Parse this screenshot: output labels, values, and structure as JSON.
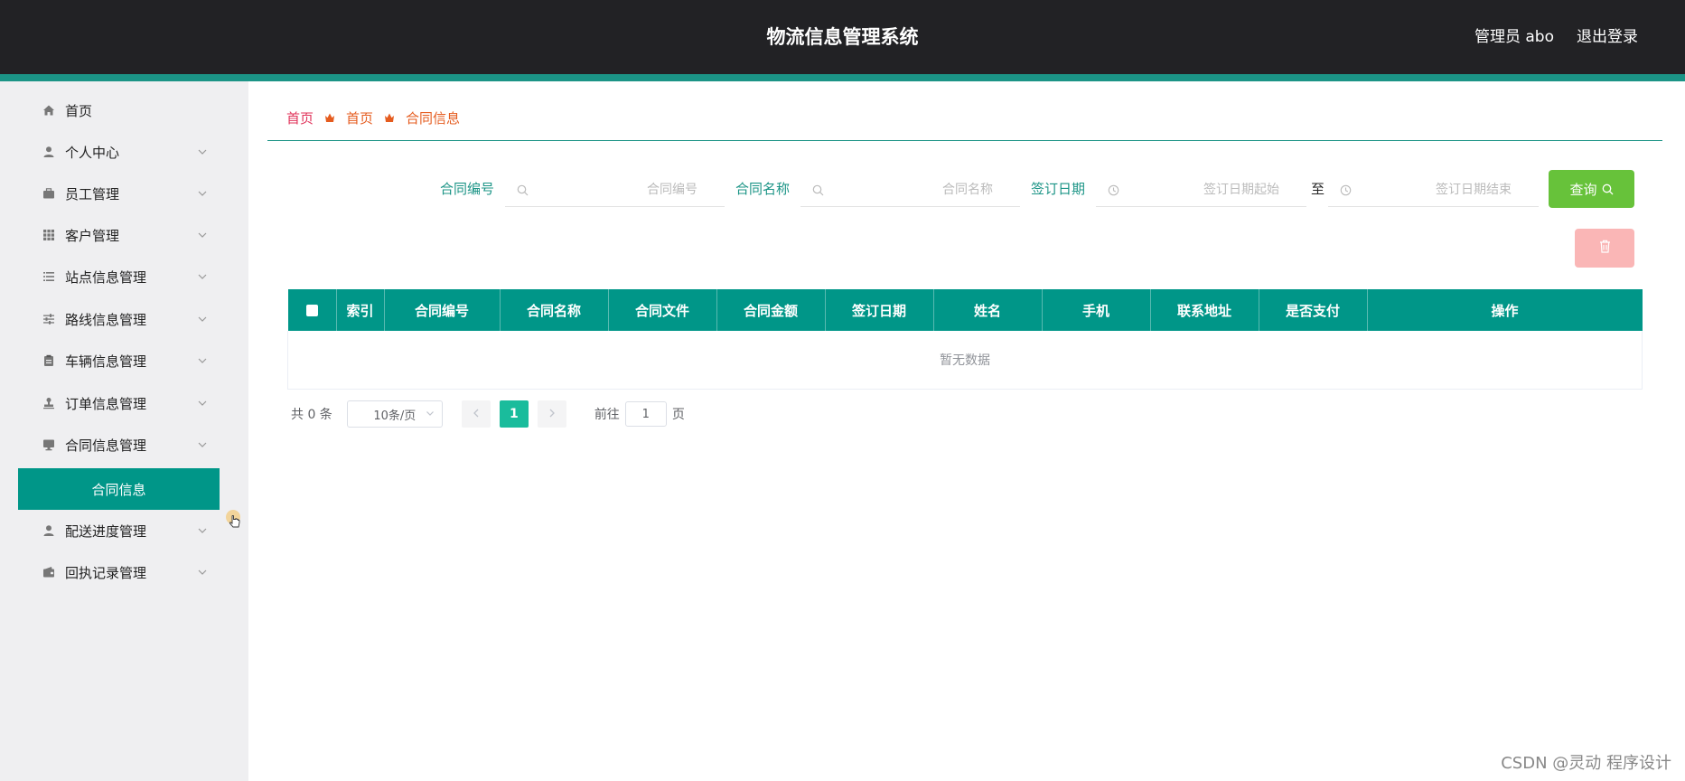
{
  "header": {
    "title": "物流信息管理系统",
    "admin": "管理员 abo",
    "logout": "退出登录"
  },
  "sidebar": {
    "items": [
      {
        "label": "首页",
        "icon": "home-icon",
        "chevron": false
      },
      {
        "label": "个人中心",
        "icon": "user-icon",
        "chevron": true
      },
      {
        "label": "员工管理",
        "icon": "briefcase-icon",
        "chevron": true
      },
      {
        "label": "客户管理",
        "icon": "grid-icon",
        "chevron": true
      },
      {
        "label": "站点信息管理",
        "icon": "list-icon",
        "chevron": true
      },
      {
        "label": "路线信息管理",
        "icon": "sliders-icon",
        "chevron": true
      },
      {
        "label": "车辆信息管理",
        "icon": "clipboard-icon",
        "chevron": true
      },
      {
        "label": "订单信息管理",
        "icon": "stamp-icon",
        "chevron": true
      },
      {
        "label": "合同信息管理",
        "icon": "monitor-icon",
        "chevron": true
      },
      {
        "label": "配送进度管理",
        "icon": "user-icon",
        "chevron": true
      },
      {
        "label": "回执记录管理",
        "icon": "wallet-icon",
        "chevron": true
      }
    ],
    "submenu_active": "合同信息"
  },
  "breadcrumb": {
    "home": "首页",
    "level1": "首页",
    "level2": "合同信息"
  },
  "search": {
    "field1_label": "合同编号",
    "field1_placeholder": "合同编号",
    "field2_label": "合同名称",
    "field2_placeholder": "合同名称",
    "field3_label": "签订日期",
    "date_start_placeholder": "签订日期起始",
    "to_label": "至",
    "date_end_placeholder": "签订日期结束",
    "query_label": "查询"
  },
  "table": {
    "columns": [
      "索引",
      "合同编号",
      "合同名称",
      "合同文件",
      "合同金额",
      "签订日期",
      "姓名",
      "手机",
      "联系地址",
      "是否支付",
      "操作"
    ],
    "empty_text": "暂无数据"
  },
  "pagination": {
    "total": "共 0 条",
    "page_size": "10条/页",
    "current_page": "1",
    "goto_label": "前往",
    "goto_value": "1",
    "page_suffix": "页"
  },
  "watermark": "CSDN @灵动 程序设计",
  "colors": {
    "primary": "#009688",
    "header_bg": "#222225",
    "query": "#67c23a",
    "delete": "#fab6b6",
    "breadcrumb": "#e55c1f"
  }
}
